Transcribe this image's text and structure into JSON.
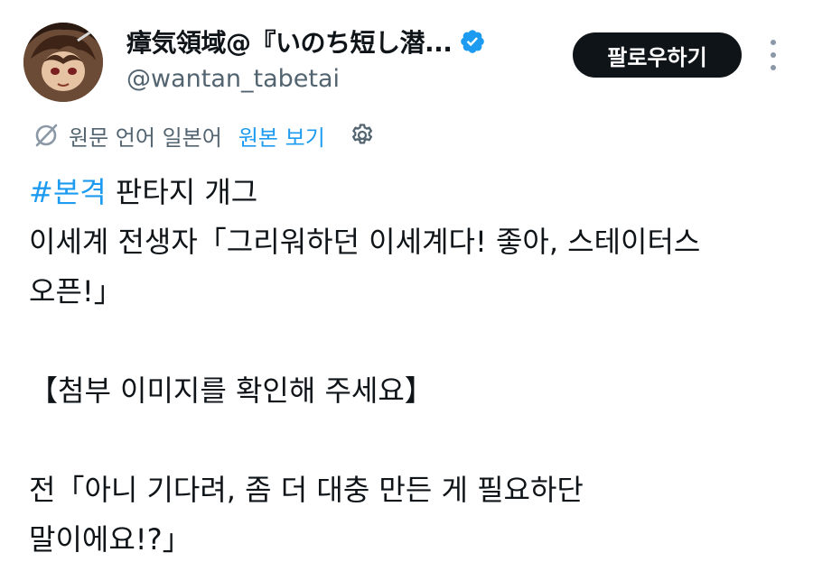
{
  "author": {
    "display_name": "瘴気領域@『いのち短し潜...",
    "handle": "@wantan_tabetai",
    "verified_icon": "verified-badge-icon",
    "avatar": "avatar-image"
  },
  "follow_button": {
    "label": "팔로우하기"
  },
  "more_button": {
    "icon": "more-vertical-icon"
  },
  "translation": {
    "icon": "translate-icon",
    "label": "원문 언어 일본어",
    "show_original": "원본 보기",
    "settings_icon": "gear-icon"
  },
  "post": {
    "hashtag": "#본격",
    "line1_rest": " 판타지 개그",
    "line2": "이세계 전생자「그리워하던 이세계다! 좋아, 스테이터스",
    "line3": "오픈!」",
    "line4": "【첨부 이미지를 확인해 주세요】",
    "line5": "전「아니 기다려, 좀 더 대충 만든 게 필요하단",
    "line6": "말이에요!?」"
  },
  "colors": {
    "link": "#1d9bf0",
    "text": "#0f1419",
    "secondary": "#536471",
    "button_bg": "#0f1419"
  }
}
